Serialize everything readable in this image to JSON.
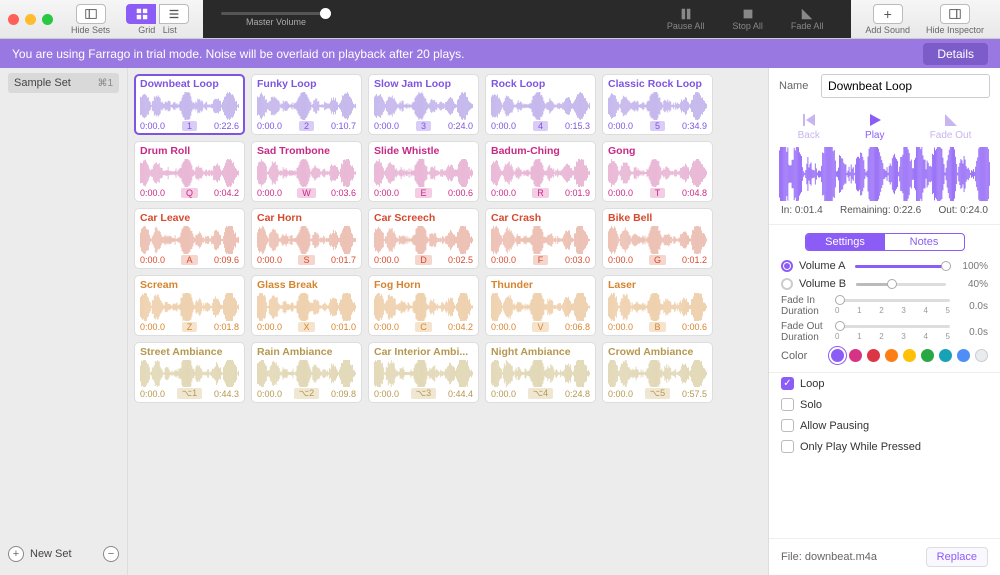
{
  "toolbar": {
    "hide_sets": "Hide Sets",
    "grid": "Grid",
    "list": "List",
    "master_volume": "Master Volume",
    "pause_all": "Pause All",
    "stop_all": "Stop All",
    "fade_all": "Fade All",
    "add_sound": "Add Sound",
    "hide_inspector": "Hide Inspector"
  },
  "banner": {
    "message": "You are using Farrago in trial mode. Noise will be overlaid on playback after 20 plays.",
    "details": "Details"
  },
  "sidebar": {
    "set_name": "Sample Set",
    "shortcut": "⌘1",
    "new_set": "New Set"
  },
  "grid": [
    [
      {
        "title": "Downbeat Loop",
        "start": "0:00.0",
        "key": "1",
        "end": "0:22.6",
        "color": "purple",
        "sel": true
      },
      {
        "title": "Funky Loop",
        "start": "0:00.0",
        "key": "2",
        "end": "0:10.7",
        "color": "purple"
      },
      {
        "title": "Slow Jam Loop",
        "start": "0:00.0",
        "key": "3",
        "end": "0:24.0",
        "color": "purple"
      },
      {
        "title": "Rock Loop",
        "start": "0:00.0",
        "key": "4",
        "end": "0:15.3",
        "color": "purple"
      },
      {
        "title": "Classic Rock Loop",
        "start": "0:00.0",
        "key": "5",
        "end": "0:34.9",
        "color": "purple"
      }
    ],
    [
      {
        "title": "Drum Roll",
        "start": "0:00.0",
        "key": "Q",
        "end": "0:04.2",
        "color": "magenta"
      },
      {
        "title": "Sad Trombone",
        "start": "0:00.0",
        "key": "W",
        "end": "0:03.6",
        "color": "magenta"
      },
      {
        "title": "Slide Whistle",
        "start": "0:00.0",
        "key": "E",
        "end": "0:00.6",
        "color": "magenta"
      },
      {
        "title": "Badum-Ching",
        "start": "0:00.0",
        "key": "R",
        "end": "0:01.9",
        "color": "magenta"
      },
      {
        "title": "Gong",
        "start": "0:00.0",
        "key": "T",
        "end": "0:04.8",
        "color": "magenta"
      }
    ],
    [
      {
        "title": "Car Leave",
        "start": "0:00.0",
        "key": "A",
        "end": "0:09.6",
        "color": "red"
      },
      {
        "title": "Car Horn",
        "start": "0:00.0",
        "key": "S",
        "end": "0:01.7",
        "color": "red"
      },
      {
        "title": "Car Screech",
        "start": "0:00.0",
        "key": "D",
        "end": "0:02.5",
        "color": "red"
      },
      {
        "title": "Car Crash",
        "start": "0:00.0",
        "key": "F",
        "end": "0:03.0",
        "color": "red"
      },
      {
        "title": "Bike Bell",
        "start": "0:00.0",
        "key": "G",
        "end": "0:01.2",
        "color": "red"
      }
    ],
    [
      {
        "title": "Scream",
        "start": "0:00.0",
        "key": "Z",
        "end": "0:01.8",
        "color": "orange"
      },
      {
        "title": "Glass Break",
        "start": "0:00.0",
        "key": "X",
        "end": "0:01.0",
        "color": "orange"
      },
      {
        "title": "Fog Horn",
        "start": "0:00.0",
        "key": "C",
        "end": "0:04.2",
        "color": "orange"
      },
      {
        "title": "Thunder",
        "start": "0:00.0",
        "key": "V",
        "end": "0:06.8",
        "color": "orange"
      },
      {
        "title": "Laser",
        "start": "0:00.0",
        "key": "B",
        "end": "0:00.6",
        "color": "orange"
      }
    ],
    [
      {
        "title": "Street Ambiance",
        "start": "0:00.0",
        "key": "⌥1",
        "end": "0:44.3",
        "color": "tan"
      },
      {
        "title": "Rain Ambiance",
        "start": "0:00.0",
        "key": "⌥2",
        "end": "0:09.8",
        "color": "tan"
      },
      {
        "title": "Car Interior Ambi...",
        "start": "0:00.0",
        "key": "⌥3",
        "end": "0:44.4",
        "color": "tan"
      },
      {
        "title": "Night Ambiance",
        "start": "0:00.0",
        "key": "⌥4",
        "end": "0:24.8",
        "color": "tan"
      },
      {
        "title": "Crowd Ambiance",
        "start": "0:00.0",
        "key": "⌥5",
        "end": "0:57.5",
        "color": "tan"
      }
    ]
  ],
  "inspector": {
    "name_label": "Name",
    "name_value": "Downbeat Loop",
    "transport": {
      "back": "Back",
      "play": "Play",
      "fade": "Fade Out"
    },
    "time_in": "In: 0:01.4",
    "time_rem": "Remaining: 0:22.6",
    "time_out": "Out: 0:24.0",
    "tabs": {
      "settings": "Settings",
      "notes": "Notes"
    },
    "vol_a_label": "Volume A",
    "vol_a_pct": "100%",
    "vol_b_label": "Volume B",
    "vol_b_pct": "40%",
    "fade_in_label": "Fade In Duration",
    "fade_in_val": "0.0s",
    "fade_out_label": "Fade Out Duration",
    "fade_out_val": "0.0s",
    "color_label": "Color",
    "colors": [
      "#8b5cf6",
      "#d63384",
      "#dc3545",
      "#fd7e14",
      "#ffc107",
      "#28a745",
      "#17a2b8",
      "#4f8ef7",
      "#e9ecef"
    ],
    "loop": "Loop",
    "solo": "Solo",
    "allow_pausing": "Allow Pausing",
    "only_pressed": "Only Play While Pressed",
    "file_label": "File:",
    "file_name": "downbeat.m4a",
    "replace": "Replace",
    "ticks": [
      "0",
      "1",
      "2",
      "3",
      "4",
      "5"
    ]
  }
}
